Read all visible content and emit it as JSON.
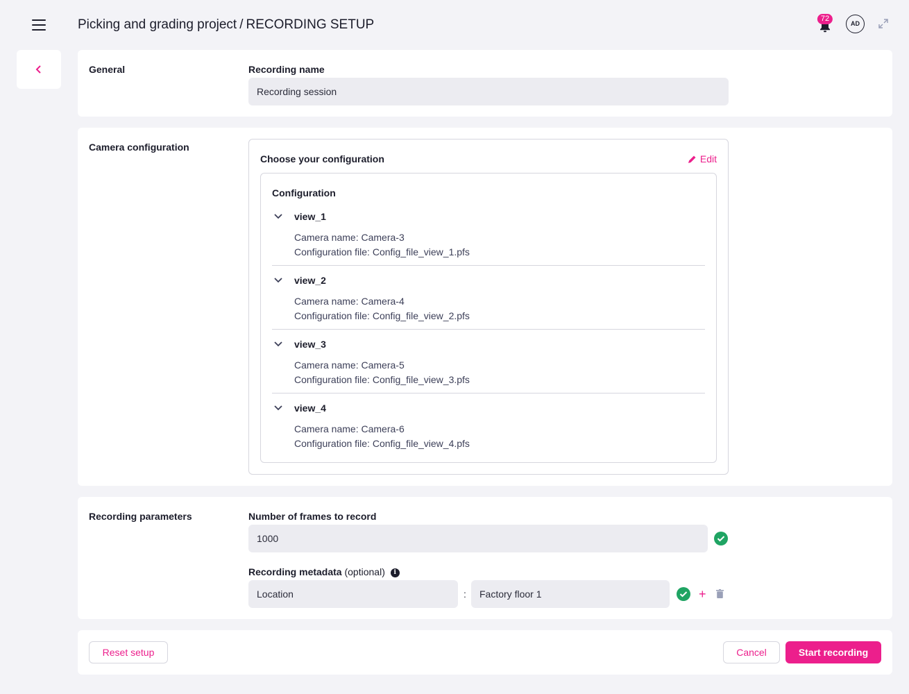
{
  "header": {
    "project": "Picking and grading project",
    "separator": "/",
    "section": "RECORDING SETUP",
    "notification_count": "72",
    "avatar_initials": "AD"
  },
  "general": {
    "label": "General",
    "recording_name_label": "Recording name",
    "recording_name_value": "Recording session"
  },
  "camera": {
    "label": "Camera configuration",
    "choose_title": "Choose your configuration",
    "edit_label": "Edit",
    "config_heading": "Configuration",
    "views": [
      {
        "name": "view_1",
        "camera": "Camera name: Camera-3",
        "file": "Configuration file: Config_file_view_1.pfs"
      },
      {
        "name": "view_2",
        "camera": "Camera name: Camera-4",
        "file": "Configuration file: Config_file_view_2.pfs"
      },
      {
        "name": "view_3",
        "camera": "Camera name: Camera-5",
        "file": "Configuration file: Config_file_view_3.pfs"
      },
      {
        "name": "view_4",
        "camera": "Camera name: Camera-6",
        "file": "Configuration file: Config_file_view_4.pfs"
      }
    ]
  },
  "params": {
    "label": "Recording parameters",
    "frames_label": "Number of frames to record",
    "frames_value": "1000",
    "metadata_label": "Recording metadata",
    "metadata_optional": "(optional)",
    "metadata_key": "Location",
    "metadata_sep": ":",
    "metadata_value": "Factory floor 1"
  },
  "footer": {
    "reset_label": "Reset setup",
    "cancel_label": "Cancel",
    "start_label": "Start recording"
  },
  "colors": {
    "accent": "#ec1f8c",
    "success": "#1fa463",
    "background": "#f3f3f7"
  },
  "icons": [
    "menu-icon",
    "bell-icon",
    "expand-icon",
    "chevron-left-icon",
    "pencil-icon",
    "chevron-down-icon",
    "check-icon",
    "info-icon",
    "plus-icon",
    "trash-icon"
  ]
}
